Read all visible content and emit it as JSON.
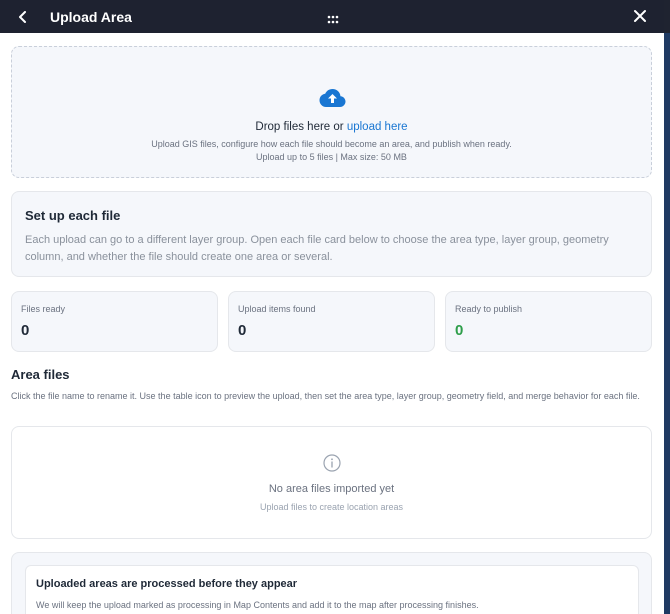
{
  "window": {
    "title": "Upload Area",
    "icons": {
      "back": "chevron-left-icon",
      "grip": "drag-grip-icon",
      "close": "close-icon"
    }
  },
  "dropzone": {
    "icon": "cloud-upload-icon",
    "prompt": "Drop files here or",
    "link": "upload here",
    "description": "Upload GIS files, configure how each file should become an area, and publish when ready.",
    "limits": "Upload up to 5 files | Max size: 50 MB"
  },
  "setup": {
    "title": "Set up each file",
    "body": "Each upload can go to a different layer group. Open each file card below to choose the area type, layer group, geometry column, and whether the file should create one area or several."
  },
  "stats": [
    {
      "label": "Files ready",
      "value": "0"
    },
    {
      "label": "Upload items found",
      "value": "0"
    },
    {
      "label": "Ready to publish",
      "value": "0"
    }
  ],
  "area_files": {
    "title": "Area files",
    "help": "Click the file name to rename it. Use the table icon to preview the upload, then set the area type, layer group, geometry field, and merge behavior for each file.",
    "empty_icon": "info-icon",
    "empty_title": "No area files imported yet",
    "empty_hint": "Upload files to create location areas"
  },
  "processing": {
    "title": "Uploaded areas are processed before they appear",
    "body": "We will keep the upload marked as processing in Map Contents and add it to the map after processing finishes."
  },
  "colors": {
    "titlebar": "#1e2230",
    "accent": "#1976d2",
    "success": "#2e9e4a",
    "card": "#f5f7fb"
  }
}
